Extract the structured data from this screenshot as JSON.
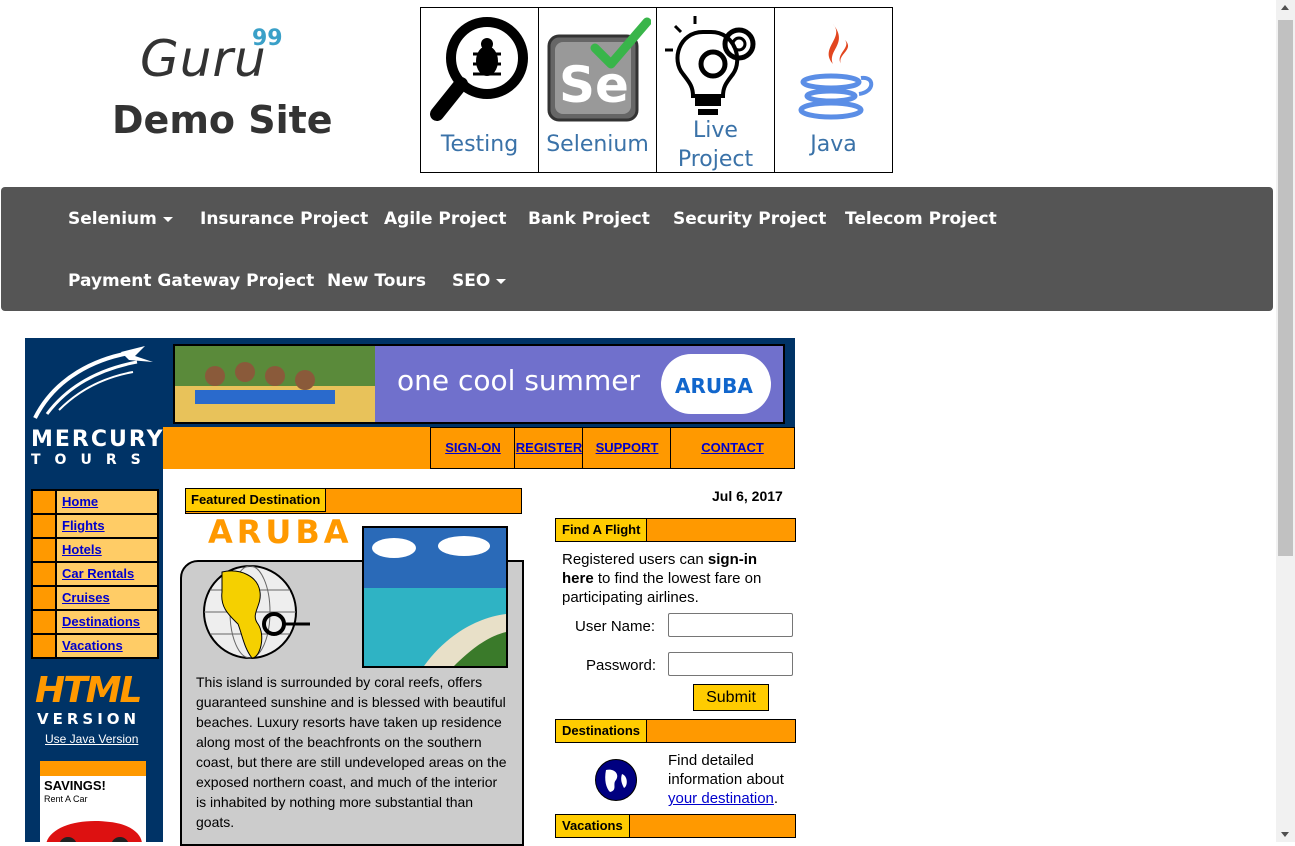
{
  "header": {
    "logo_text": "Guru",
    "logo_superscript": "99",
    "site_title": "Demo Site",
    "tiles": [
      {
        "label": "Testing",
        "icon": "magnifier-bug-icon"
      },
      {
        "label": "Selenium",
        "icon": "selenium-icon"
      },
      {
        "label_line1": "Live",
        "label_line2": "Project",
        "icon": "lightbulb-gear-icon"
      },
      {
        "label": "Java",
        "icon": "java-icon"
      }
    ]
  },
  "nav": {
    "items": [
      "Selenium",
      "Insurance Project",
      "Agile Project",
      "Bank Project",
      "Security Project",
      "Telecom Project",
      "Payment Gateway Project",
      "New Tours",
      "SEO"
    ]
  },
  "mercury": {
    "logo_line1": "MERCURY",
    "logo_line2": "TOURS",
    "banner_text": "one cool summer",
    "banner_brand": "ARUBA",
    "top_links": [
      "SIGN-ON",
      "REGISTER",
      "SUPPORT",
      "CONTACT"
    ],
    "side_menu": [
      "Home",
      "Flights",
      "Hotels",
      "Car Rentals",
      "Cruises",
      "Destinations",
      "Vacations"
    ],
    "html_version_title": "HTML",
    "html_version_label": "VERSION",
    "java_version_link": "Use Java Version",
    "savings_title": "SAVINGS!",
    "savings_sub": "Rent A Car",
    "featured": {
      "label": "Featured Destination",
      "title": "ARUBA",
      "text": "This island is surrounded by coral reefs, offers guaranteed sunshine and is blessed with beautiful beaches. Luxury resorts have taken up residence along most of the beachfronts on the southern coast, but there are still undeveloped areas on the exposed northern coast, and much of the interior is inhabited by nothing more substantial than goats."
    },
    "date": "Jul 6, 2017",
    "find_flight": {
      "label": "Find A Flight",
      "text_pre": "Registered users can ",
      "text_bold": "sign-in here",
      "text_post": " to find the lowest fare on participating airlines.",
      "username_label": "User Name:",
      "password_label": "Password:",
      "username_value": "",
      "password_value": "",
      "submit_label": "Submit"
    },
    "destinations": {
      "label": "Destinations",
      "text": "Find detailed information about ",
      "link": "your destination",
      "text_end": "."
    },
    "vacations": {
      "label": "Vacations"
    }
  },
  "colors": {
    "nav_bg": "#555555",
    "tile_text": "#3a72a8",
    "mercury_navy": "#003366",
    "mercury_orange": "#ff9900",
    "mercury_yellow": "#ffcc00",
    "link": "#0000cc"
  }
}
